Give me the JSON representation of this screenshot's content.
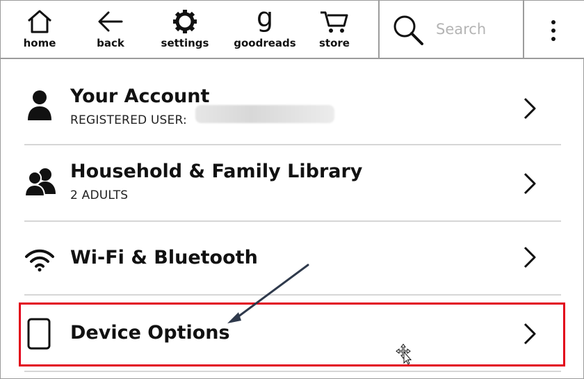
{
  "toolbar": {
    "home": {
      "label": "home",
      "icon": "home-icon"
    },
    "back": {
      "label": "back",
      "icon": "back-arrow-icon"
    },
    "settings": {
      "label": "settings",
      "icon": "gear-icon"
    },
    "goodreads": {
      "label": "goodreads",
      "glyph": "g",
      "icon": "goodreads-icon"
    },
    "store": {
      "label": "store",
      "icon": "cart-icon"
    },
    "search": {
      "placeholder": "Search",
      "icon": "search-icon"
    },
    "menu": {
      "icon": "more-vertical-icon"
    }
  },
  "settings_list": [
    {
      "title": "Your Account",
      "subtitle": "REGISTERED USER:",
      "subtitle_value_redacted": true,
      "icon": "person-icon"
    },
    {
      "title": "Household & Family Library",
      "subtitle": "2 ADULTS",
      "icon": "people-icon"
    },
    {
      "title": "Wi-Fi & Bluetooth",
      "subtitle": "",
      "icon": "wifi-icon"
    },
    {
      "title": "Device Options",
      "subtitle": "",
      "icon": "tablet-icon",
      "highlighted": true
    }
  ],
  "annotation": {
    "highlight_color": "#e2001a",
    "arrow_color": "#2f3a4c"
  },
  "colors": {
    "divider": "#d6d6d6",
    "toolbar_border": "#9c9c9c",
    "placeholder": "#b4b4b4"
  }
}
